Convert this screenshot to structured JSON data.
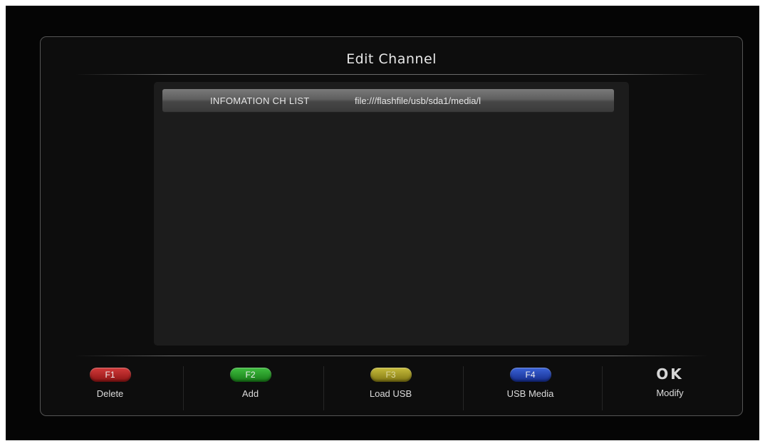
{
  "window": {
    "title": "Edit Channel"
  },
  "list": {
    "rows": [
      {
        "name": "INFOMATION  CH  LIST",
        "path": "file:///flashfile/usb/sda1/media/l"
      }
    ]
  },
  "function_keys": [
    {
      "key": "F1",
      "label": "Delete",
      "color": "#b01e1e",
      "icon": "red-f1-pill"
    },
    {
      "key": "F2",
      "label": "Add",
      "color": "#22992a",
      "icon": "green-f2-pill"
    },
    {
      "key": "F3",
      "label": "Load USB",
      "color": "#a89b1f",
      "icon": "yellow-f3-pill"
    },
    {
      "key": "F4",
      "label": "USB Media",
      "color": "#2546b3",
      "icon": "blue-f4-pill"
    },
    {
      "key": "OK",
      "label": "Modify",
      "color": "#d6d6d6",
      "icon": "ok-key"
    }
  ]
}
